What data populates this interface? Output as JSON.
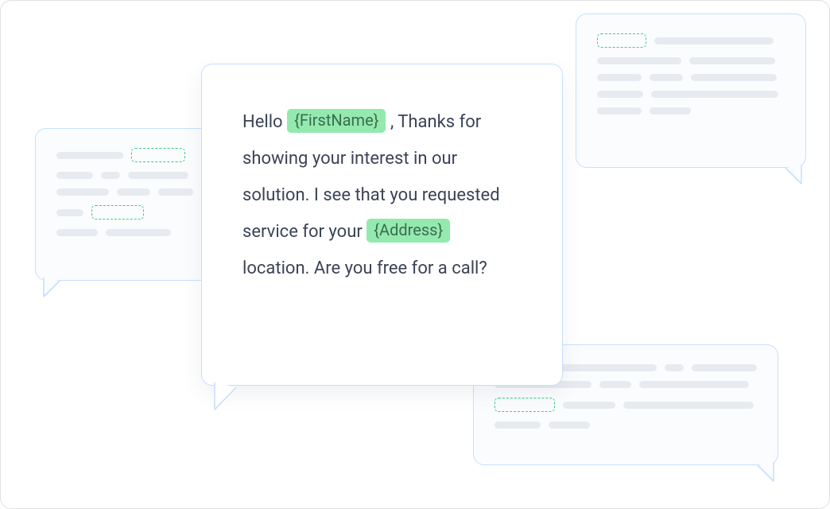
{
  "main_bubble": {
    "text_before_name": "Hello ",
    "tag_first_name": "{FirstName}",
    "text_after_name": " , Thanks for showing your interest in our solution. I see that you requested service for your ",
    "tag_address": "{Address}",
    "text_after_address": " location. Are you free for a call?"
  }
}
